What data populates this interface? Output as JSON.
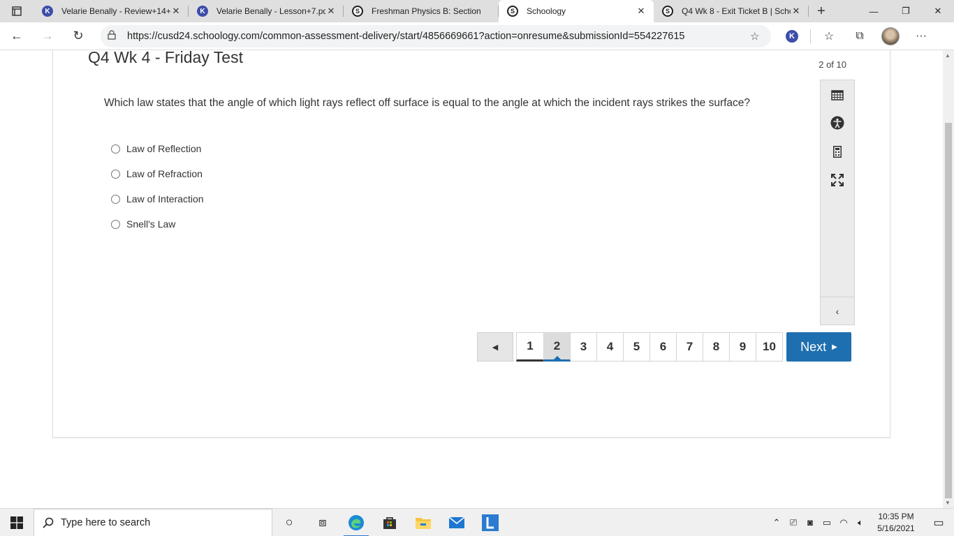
{
  "browser": {
    "tabs": [
      {
        "title": "Velarie Benally - Review+14+",
        "favicon": "K",
        "active": false
      },
      {
        "title": "Velarie Benally - Lesson+7.pd",
        "favicon": "K",
        "active": false
      },
      {
        "title": "Freshman Physics B: Section",
        "favicon": "S",
        "active": false
      },
      {
        "title": "Schoology",
        "favicon": "S",
        "active": true
      },
      {
        "title": "Q4 Wk 8 - Exit Ticket B | Scho",
        "favicon": "S",
        "active": false
      }
    ],
    "url": "https://cusd24.schoology.com/common-assessment-delivery/start/4856669661?action=onresume&submissionId=554227615"
  },
  "test": {
    "title": "Q4 Wk 4 - Friday Test",
    "progress": "2 of 10",
    "question": "Which law states that the angle of which light rays reflect off surface is equal to the angle at which the incident rays strikes the surface?",
    "options": [
      "Law of Reflection",
      "Law of Refraction",
      "Law of Interaction",
      "Snell's Law"
    ]
  },
  "pager": {
    "pages": [
      "1",
      "2",
      "3",
      "4",
      "5",
      "6",
      "7",
      "8",
      "9",
      "10"
    ],
    "current": "2",
    "next_label": "Next"
  },
  "taskbar": {
    "search_placeholder": "Type here to search",
    "time": "10:35 PM",
    "date": "5/16/2021"
  },
  "colors": {
    "accent": "#1e6fb0",
    "tab_bar": "#dfdfdf",
    "tools_bg": "#ebebeb"
  }
}
